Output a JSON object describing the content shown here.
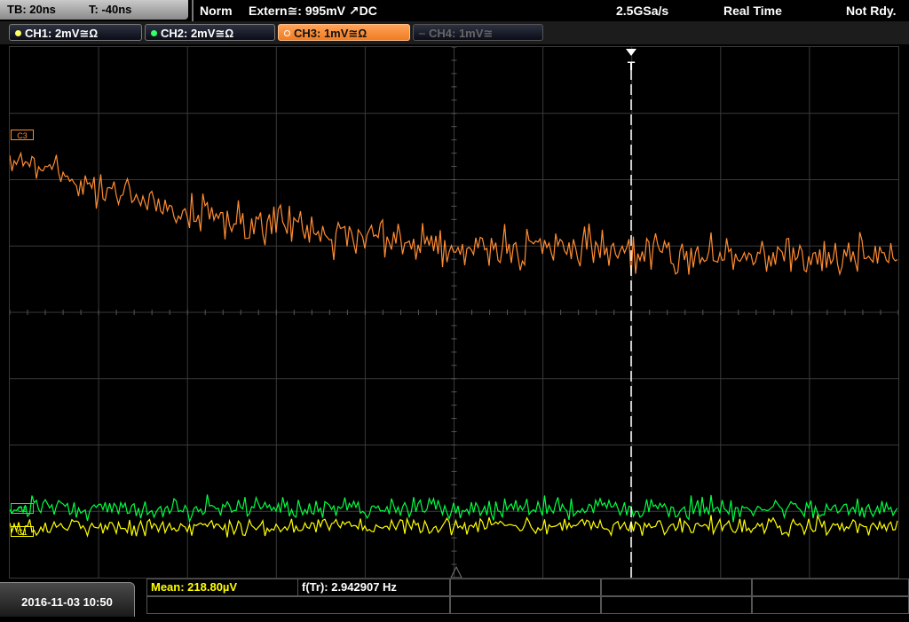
{
  "topbar": {
    "timebase": "TB: 20ns",
    "trigger_time": "T: -40ns",
    "trigger_mode": "Norm",
    "trigger_source": "Extern≅: 995mV ↗DC",
    "sample_rate": "2.5GSa/s",
    "acq_mode": "Real Time",
    "status": "Not Rdy."
  },
  "channels": [
    {
      "label": "CH1: 2mV≅Ω",
      "color": "#ffff00",
      "state": "on"
    },
    {
      "label": "CH2: 2mV≅Ω",
      "color": "#00ff44",
      "state": "on"
    },
    {
      "label": "CH3: 1mV≅Ω",
      "color": "#ff8c33",
      "state": "active"
    },
    {
      "label": "CH4: 1mV≅",
      "color": "#555555",
      "state": "off"
    }
  ],
  "markers": {
    "ch3": "C3",
    "ch2": "C2",
    "ch1": "C1",
    "trigger": "T"
  },
  "measurements": {
    "mean": "Mean: 218.80µV",
    "frequency": "f(Tr): 2.942907 Hz"
  },
  "datetime": "2016-11-03 10:50",
  "colors": {
    "ch1": "#ffff00",
    "ch2": "#00ff44",
    "ch3": "#ff8c33",
    "grid": "#3a3a3a",
    "measure_text": "#ffff00"
  }
}
